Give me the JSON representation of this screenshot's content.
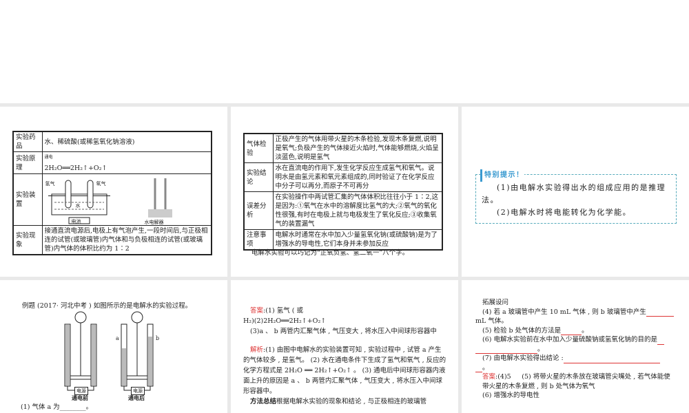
{
  "slide1": {
    "rows": [
      {
        "h": "实验药品",
        "c": "水、稀硫酸(或稀氢氧化钠溶液)"
      },
      {
        "h": "实验原理",
        "c": "2H₂O══2H₂↑+O₂↑",
        "cond": "通电"
      },
      {
        "h": "实验装置",
        "c": ""
      },
      {
        "h": "实验现象",
        "c": "接通直流电源后,电极上有气泡产生,一段时间后,与正极相连的试管(或玻璃管)内气体和与负极相连的试管(或玻璃管)内气体的体积比约为 1∶2"
      }
    ],
    "fig": {
      "h2": "氢气",
      "o2": "氧气",
      "water": "水",
      "battery": "电池",
      "device": "水电解器"
    }
  },
  "slide2": {
    "rows": [
      {
        "h": "气体检验",
        "c": "正极产生的气体用带火星的木条检验,发现木条复燃,说明是氧气;负极产生的气体接近火焰时,气体能够燃烧,火焰呈淡蓝色,说明是氢气"
      },
      {
        "h": "实验结论",
        "c": "水在直流电的作用下,发生化学反应生成氢气和氧气。说明水是由氢元素和氧元素组成的,同时验证了在化学反应中分子可以再分,而原子不可再分"
      },
      {
        "h": "误差分析",
        "c": "在实验操作中两试管汇集的气体体积比往往小于 1∶2,这是因为:①氧气在水中的溶解度比氢气的大;②氧气的氧化性很强,有时在电极上就与电极发生了氧化反应;③收集氧气的装置漏气"
      },
      {
        "h": "注意事项",
        "c": "电解水时通常在水中加入少量氢氧化钠(或硫酸钠)是为了增强水的导电性,它们本身并未参加反应"
      }
    ],
    "note": "电解水实验可以巧记为“正氧负氢、氢二氧一”八个字。"
  },
  "slide3": {
    "title": "特别提示！",
    "p1": "(1)由电解水实验得出水的组成应用的是推理法。",
    "p2": "(2)电解水时将电能转化为化学能。"
  },
  "slide4": {
    "question": "例题 (2017· 河北中考 ) 如图所示的是电解水的实验过程。",
    "before": "通电前",
    "after": "通电后",
    "power": "电源",
    "a": "a",
    "b": "b",
    "q1": "(1) 气体 a 为________。"
  },
  "slide5": {
    "ans_label": "答案",
    "ans1": ":(1) 氢气 ( 或",
    "ans2": "H₂)(2)2H₂O══2H₂↑+O₂↑",
    "ans3": "(3)a 、 b 两管内汇聚气体 , 气压变大 , 将水压入中间球形容器中",
    "ana_label": "解析",
    "ana": ":(1) 由图中电解水的实验装置可知 , 实验过程中 , 试管 a 产生的气体较多 , 是氢气。 (2) 水在通电条件下生成了氢气和氧气 , 反应的化学方程式是 2H₂O ══ 2H₂↑+O₂↑ 。 (3) 通电后中间球形容器内液面上升的原因是 a 、 b 两管内汇聚气体 , 气压变大 , 将水压入中间球形容器中。",
    "method_label": "方法总结",
    "method": "根据电解水实验的现象和结论 , 与正极相连的玻璃管"
  },
  "slide6": {
    "title": "拓展设问",
    "q4a": "(4) 若 a 玻璃管中产生 10 mL 气体 , 则 b 玻璃管中产生",
    "q4b": "mL 气体。",
    "q5": "(5) 检验 b 处气体的方法是",
    "q6": "(6) 电解水实验前在水中加入少量硫酸钠或氢氧化钠的目的是",
    "q7": "(7) 由电解水实验得出结论 :",
    "ans_label": "答案",
    "ans": ":(4)5 　 (5) 将带火星的木条放在玻璃管尖嘴处 , 若气体能使带火星的木条复燃 , 则 b 处气体为氧气",
    "ans_next": "(6) 增强水的导电性"
  }
}
